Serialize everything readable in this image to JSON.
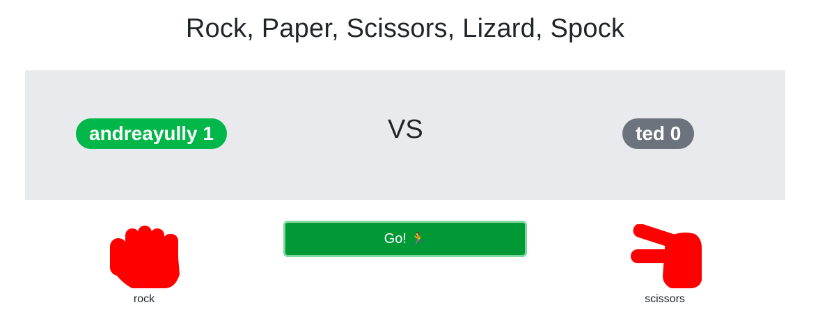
{
  "title": "Rock, Paper, Scissors, Lizard, Spock",
  "scoreboard": {
    "player1": "andreayully 1",
    "vs": "VS",
    "player2": "ted 0"
  },
  "go_button": {
    "label": "Go!",
    "icon": "🏃"
  },
  "hands": {
    "left_label": "rock",
    "right_label": "scissors"
  },
  "colors": {
    "player1_badge": "#02b74a",
    "player2_badge": "#6c737c",
    "go_button": "#009935",
    "hand": "#ff0000",
    "scoreboard_bg": "#e9eaed"
  }
}
